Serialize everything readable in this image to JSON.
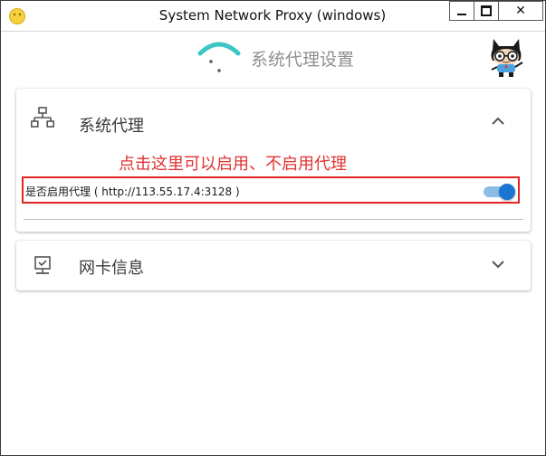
{
  "window": {
    "title": "System Network Proxy (windows)",
    "controls": {
      "minimize": "minimize",
      "maximize": "maximize",
      "close": "✕"
    }
  },
  "header": {
    "title": "系统代理设置",
    "accent": "#3ec6c6"
  },
  "proxy_panel": {
    "title": "系统代理",
    "icon": "network-icon",
    "expanded": true,
    "annotation": "点击这里可以启用、不启用代理",
    "toggle_label": "是否启用代理 ( http://113.55.17.4:3128 )",
    "toggle_on": true,
    "toggle_color": "#1976d2"
  },
  "nic_panel": {
    "title": "网卡信息",
    "icon": "computer-icon",
    "expanded": false
  },
  "colors": {
    "annotation": "#e23232",
    "highlight_box": "#e52424"
  }
}
